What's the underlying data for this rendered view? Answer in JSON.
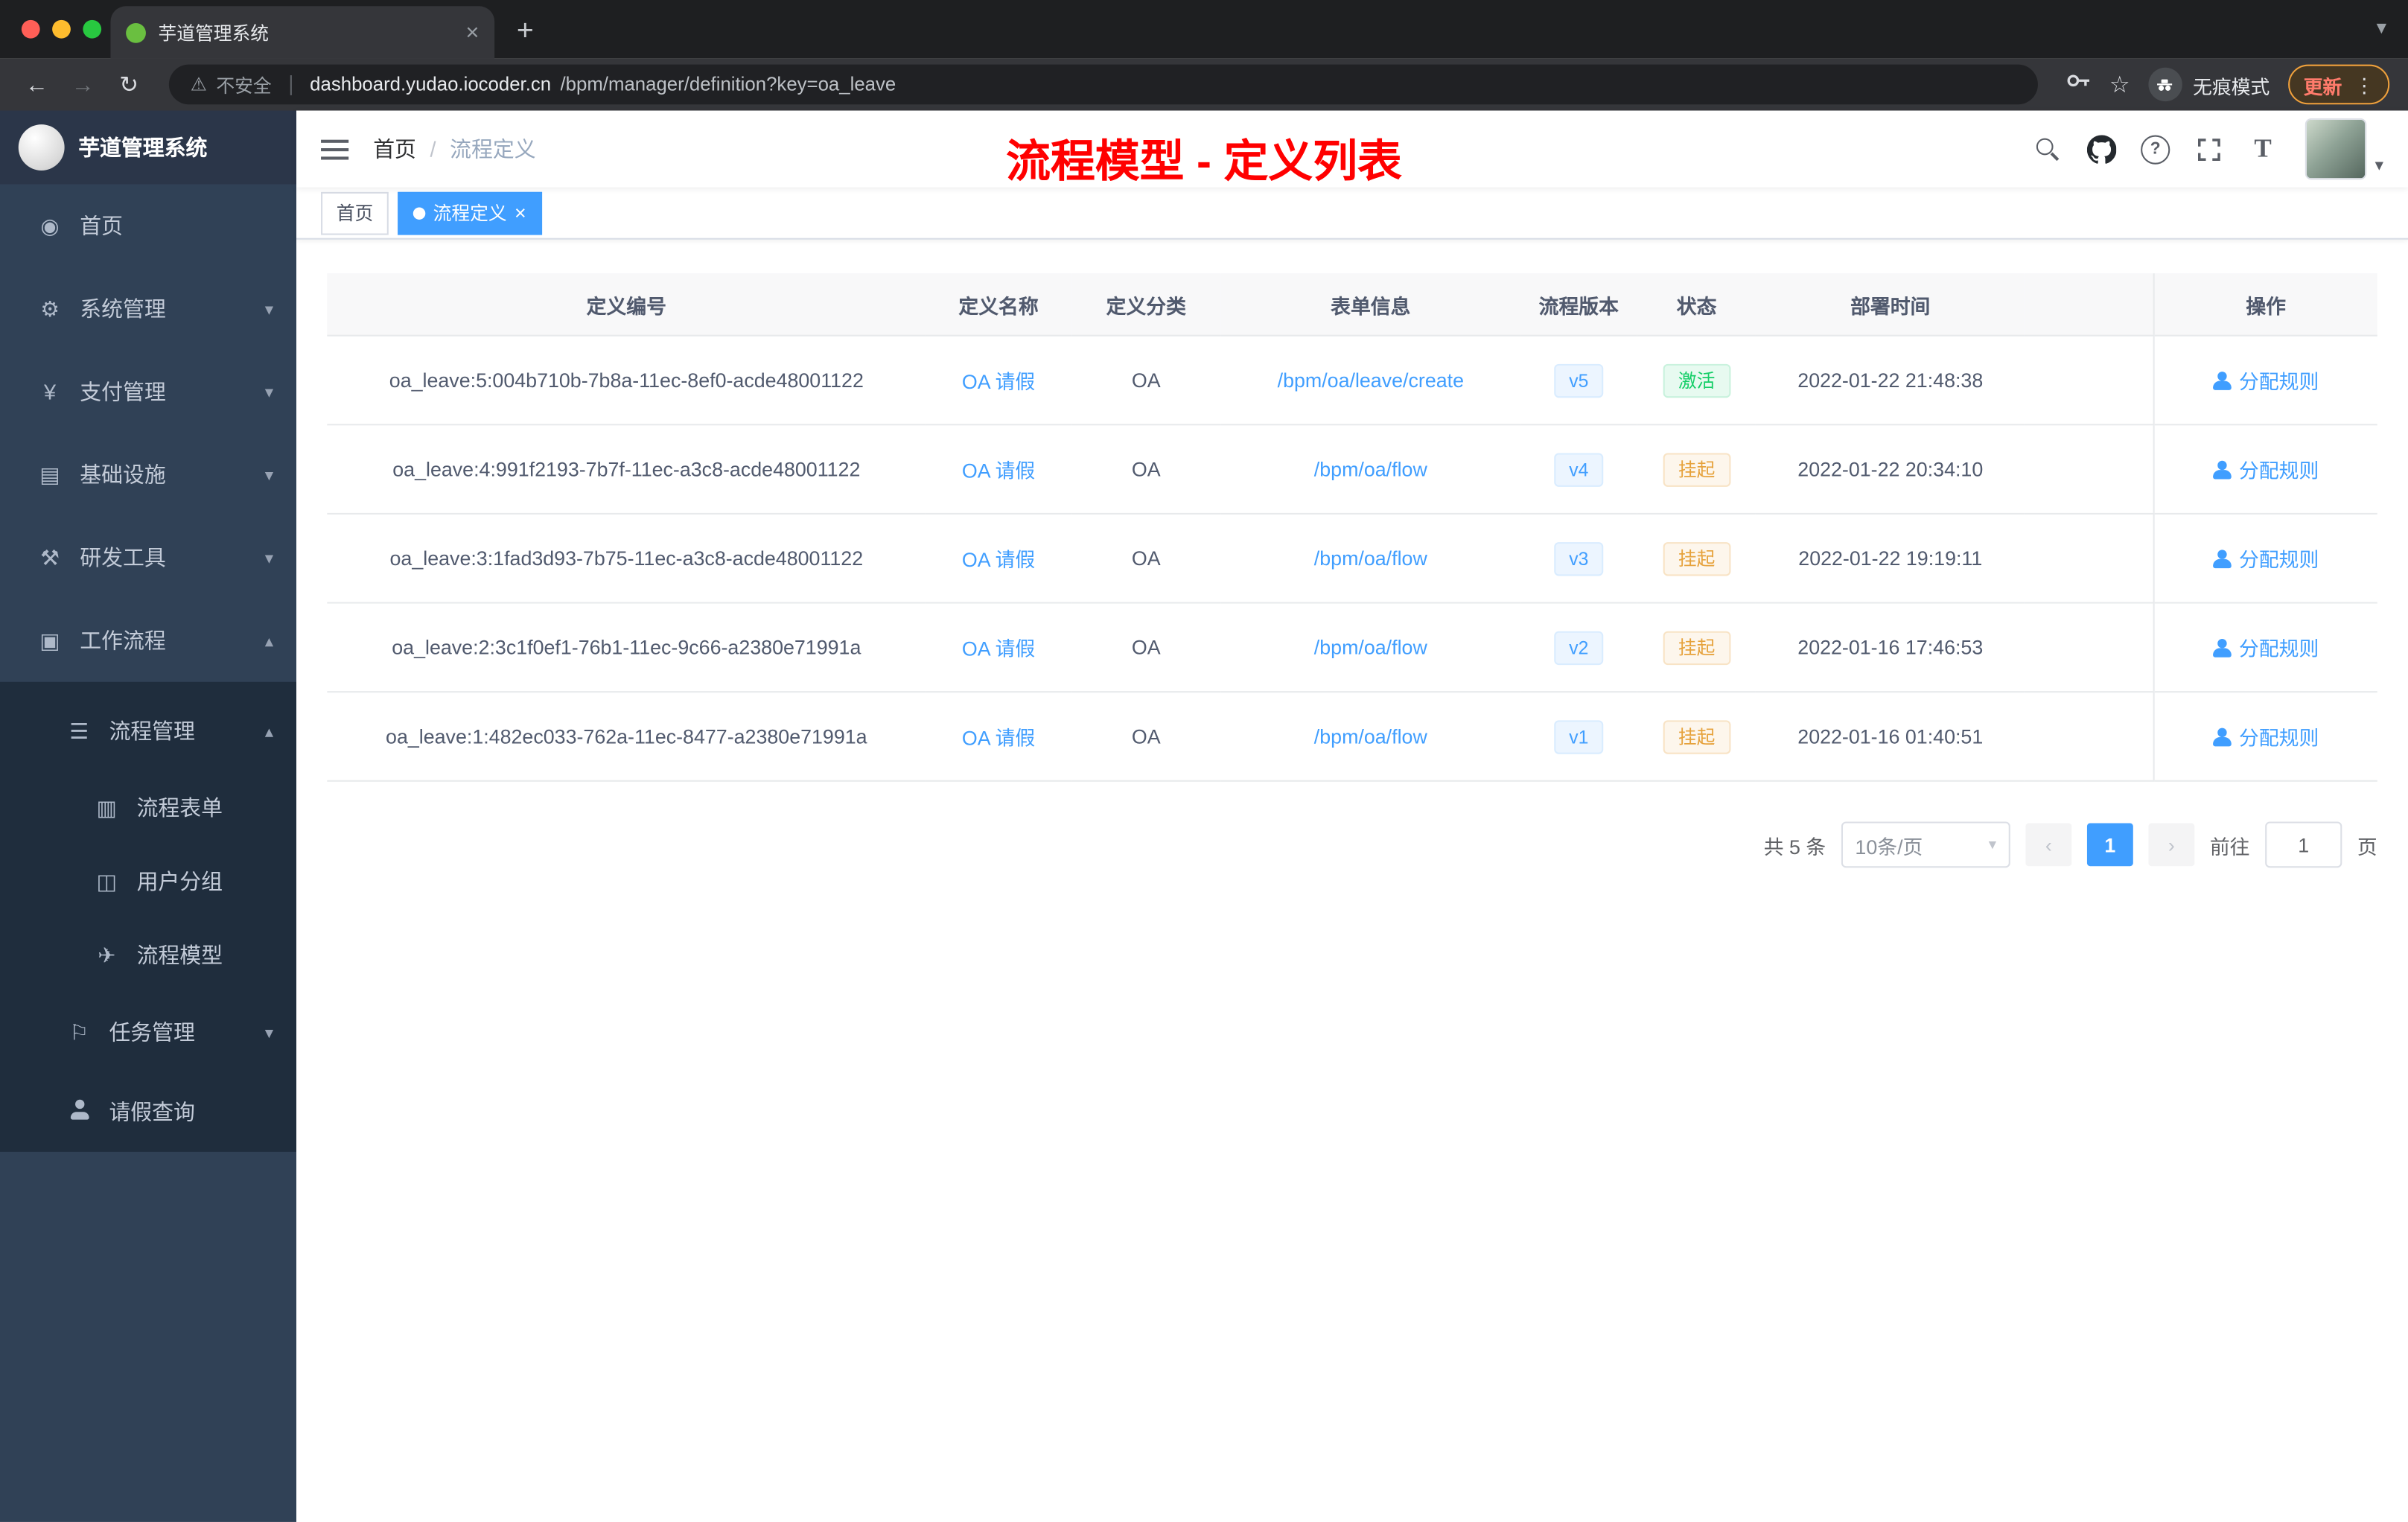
{
  "browser": {
    "tab_title": "芋道管理系统",
    "security_label": "不安全",
    "url_domain": "dashboard.yudao.iocoder.cn",
    "url_path": "/bpm/manager/definition?key=oa_leave",
    "incognito_label": "无痕模式",
    "update_label": "更新"
  },
  "sidebar": {
    "title": "芋道管理系统",
    "items": [
      {
        "label": "首页"
      },
      {
        "label": "系统管理"
      },
      {
        "label": "支付管理"
      },
      {
        "label": "基础设施"
      },
      {
        "label": "研发工具"
      },
      {
        "label": "工作流程"
      },
      {
        "label": "流程管理"
      },
      {
        "label": "流程表单"
      },
      {
        "label": "用户分组"
      },
      {
        "label": "流程模型"
      },
      {
        "label": "任务管理"
      },
      {
        "label": "请假查询"
      }
    ]
  },
  "header": {
    "breadcrumb_home": "首页",
    "breadcrumb_sep": "/",
    "breadcrumb_current": "流程定义",
    "annotation": "流程模型 - 定义列表"
  },
  "tags": {
    "home": "首页",
    "current": "流程定义"
  },
  "table": {
    "columns": [
      "定义编号",
      "定义名称",
      "定义分类",
      "表单信息",
      "流程版本",
      "状态",
      "部署时间",
      "操作"
    ],
    "rows": [
      {
        "id": "oa_leave:5:004b710b-7b8a-11ec-8ef0-acde48001122",
        "name": "OA 请假",
        "category": "OA",
        "form": "/bpm/oa/leave/create",
        "version": "v5",
        "status": "激活",
        "time": "2022-01-22 21:48:38",
        "action": "分配规则"
      },
      {
        "id": "oa_leave:4:991f2193-7b7f-11ec-a3c8-acde48001122",
        "name": "OA 请假",
        "category": "OA",
        "form": "/bpm/oa/flow",
        "version": "v4",
        "status": "挂起",
        "time": "2022-01-22 20:34:10",
        "action": "分配规则"
      },
      {
        "id": "oa_leave:3:1fad3d93-7b75-11ec-a3c8-acde48001122",
        "name": "OA 请假",
        "category": "OA",
        "form": "/bpm/oa/flow",
        "version": "v3",
        "status": "挂起",
        "time": "2022-01-22 19:19:11",
        "action": "分配规则"
      },
      {
        "id": "oa_leave:2:3c1f0ef1-76b1-11ec-9c66-a2380e71991a",
        "name": "OA 请假",
        "category": "OA",
        "form": "/bpm/oa/flow",
        "version": "v2",
        "status": "挂起",
        "time": "2022-01-16 17:46:53",
        "action": "分配规则"
      },
      {
        "id": "oa_leave:1:482ec033-762a-11ec-8477-a2380e71991a",
        "name": "OA 请假",
        "category": "OA",
        "form": "/bpm/oa/flow",
        "version": "v1",
        "status": "挂起",
        "time": "2022-01-16 01:40:51",
        "action": "分配规则"
      }
    ]
  },
  "pagination": {
    "total": "共 5 条",
    "page_size": "10条/页",
    "page": "1",
    "goto_label": "前往",
    "goto_value": "1",
    "page_unit": "页"
  },
  "colors": {
    "accent": "#409eff",
    "success": "#13ce66",
    "warning": "#e6a23c",
    "annotation": "#ff0000",
    "sidebar_bg": "#304156",
    "submenu_bg": "#1f2d3d"
  },
  "icons": {
    "dashboard": "◉",
    "gear": "⚙",
    "yen": "¥",
    "infra": "▤",
    "tools": "⚒",
    "workflow": "▣",
    "list": "☰",
    "form": "▥",
    "group": "◫",
    "send": "✈",
    "task": "⚐",
    "warning-triangle": "⚠",
    "back": "←",
    "forward": "→",
    "reload": "↻",
    "star": "☆",
    "chevron-down": "▾",
    "chevron-up": "▴",
    "close": "×",
    "plus": "+",
    "prev": "‹",
    "next": "›",
    "dot-menu": "⋮",
    "question": "?",
    "font-size": "T"
  }
}
